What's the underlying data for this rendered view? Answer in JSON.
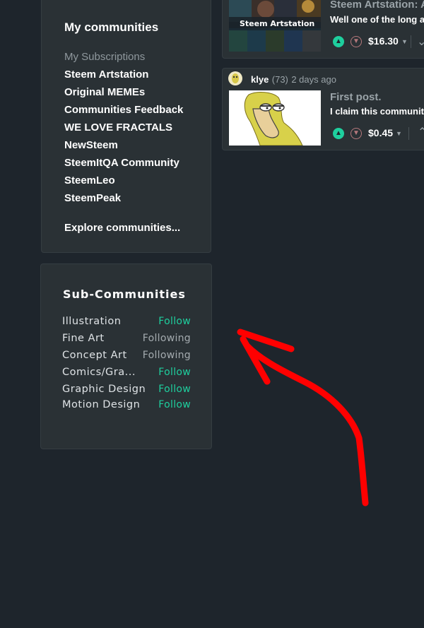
{
  "my_communities": {
    "title": "My communities",
    "subscriptions_heading": "My Subscriptions",
    "items": [
      {
        "label": "Steem Artstation"
      },
      {
        "label": "Original MEMEs"
      },
      {
        "label": "Communities Feedback"
      },
      {
        "label": "WE LOVE FRACTALS"
      },
      {
        "label": "NewSteem"
      },
      {
        "label": "SteemItQA Community"
      },
      {
        "label": "SteemLeo"
      },
      {
        "label": "SteemPeak"
      }
    ],
    "explore_label": "Explore communities..."
  },
  "sub_communities": {
    "title": "Sub-Communities",
    "items": [
      {
        "name": "Illustration",
        "status": "Follow",
        "following": false
      },
      {
        "name": "Fine Art",
        "status": "Following",
        "following": true
      },
      {
        "name": "Concept Art",
        "status": "Following",
        "following": true
      },
      {
        "name": "Comics/Gra...",
        "status": "Follow",
        "following": false
      },
      {
        "name": "Graphic Design",
        "status": "Follow",
        "following": false
      },
      {
        "name": "Motion Design",
        "status": "Follow",
        "following": false
      }
    ]
  },
  "posts": [
    {
      "thumb_caption": "Steem Artstation",
      "title": "Steem Artstation: A",
      "excerpt": "Well one of the long aw",
      "payout": "$16.30"
    },
    {
      "author": "klye",
      "reputation": "(73)",
      "time": "2 days ago",
      "title": "First post.",
      "excerpt": "I claim this communitu",
      "payout": "$0.45"
    }
  ],
  "colors": {
    "background": "#1e252c",
    "panel": "#2a3135",
    "accent_follow": "#1ecf9e",
    "annotation_arrow": "#ff0000"
  },
  "icons": {
    "upvote": "chevron-up-circle",
    "downvote": "chevron-down-circle",
    "dropdown": "caret-down"
  }
}
